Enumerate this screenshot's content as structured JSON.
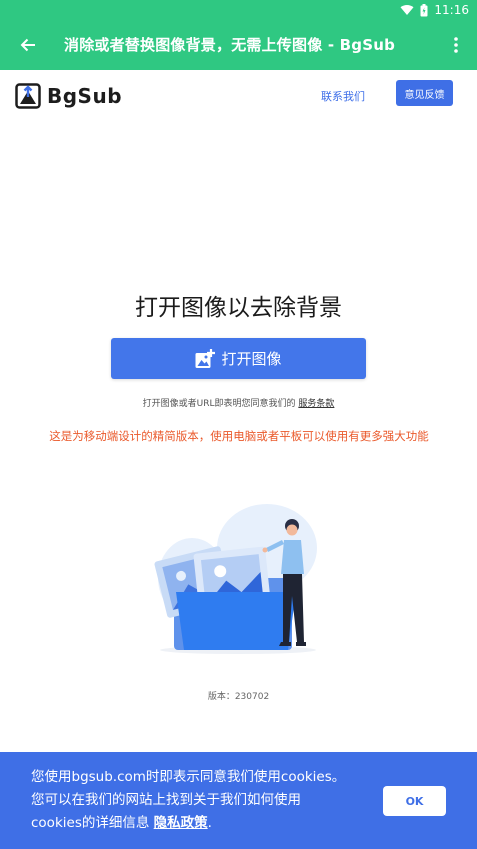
{
  "status_bar": {
    "time": "11:16"
  },
  "app_bar": {
    "title": "消除或者替换图像背景，无需上传图像 - BgSub"
  },
  "header": {
    "logo_text": "BgSub",
    "contact_label": "联系我们",
    "feedback_label": "意见反馈"
  },
  "main": {
    "title": "打开图像以去除背景",
    "open_button_label": "打开图像",
    "terms_prefix": "打开图像或者URL即表明您同意我们的",
    "terms_link": "服务条款",
    "mobile_note": "这是为移动端设计的精简版本，使用电脑或者平板可以使用有更多强大功能",
    "version": "版本：230702"
  },
  "cookie": {
    "text": "您使用bgsub.com时即表示同意我们使用cookies。您可以在我们的网站上找到关于我们如何使用cookies的详细信息",
    "privacy_link": "隐私政策",
    "suffix": ".",
    "ok_label": "OK"
  },
  "colors": {
    "app_bar": "#2fc882",
    "accent_blue": "#3f6fe6",
    "note_orange": "#ea5a2c"
  },
  "icons": [
    "wifi-icon",
    "battery-icon",
    "back-arrow-icon",
    "more-vert-icon",
    "logo-icon",
    "add-image-icon"
  ]
}
